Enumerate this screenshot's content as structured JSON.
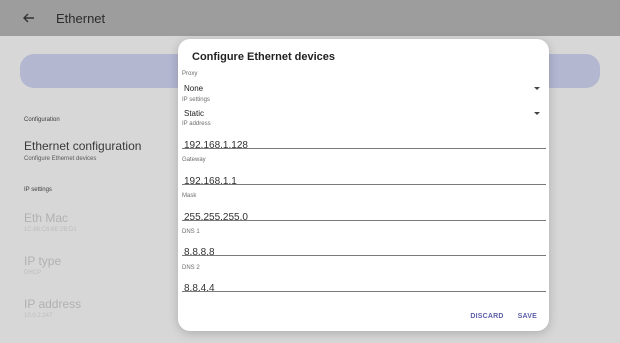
{
  "appbar": {
    "title": "Ethernet"
  },
  "background": {
    "configuration_header": "Configuration",
    "ethernet_configuration_title": "Ethernet configuration",
    "ethernet_configuration_sub": "Configure Ethernet devices",
    "ip_settings_header": "IP settings",
    "eth_mac_title": "Eth Mac",
    "eth_mac_value": "1C:88:C6:8E:2B:D1",
    "ip_type_title": "IP type",
    "ip_type_value": "DHCP",
    "ip_address_title": "IP address",
    "ip_address_value": "10.0.2.247"
  },
  "dialog": {
    "title": "Configure Ethernet devices",
    "proxy": {
      "label": "Proxy",
      "value": "None"
    },
    "ip_settings": {
      "label": "IP settings",
      "value": "Static"
    },
    "ip_address": {
      "label": "IP address",
      "value": "192.168.1.128"
    },
    "gateway": {
      "label": "Gateway",
      "value": "192.168.1.1"
    },
    "mask": {
      "label": "Mask",
      "value": "255.255.255.0"
    },
    "dns1": {
      "label": "DNS 1",
      "value": "8.8.8.8"
    },
    "dns2": {
      "label": "DNS 2",
      "value": "8.8.4.4"
    },
    "discard_label": "DISCARD",
    "save_label": "SAVE"
  },
  "colors": {
    "accent": "#5b5fa8",
    "scrim": "#9d9d9d",
    "card": "#b3b7d0"
  }
}
